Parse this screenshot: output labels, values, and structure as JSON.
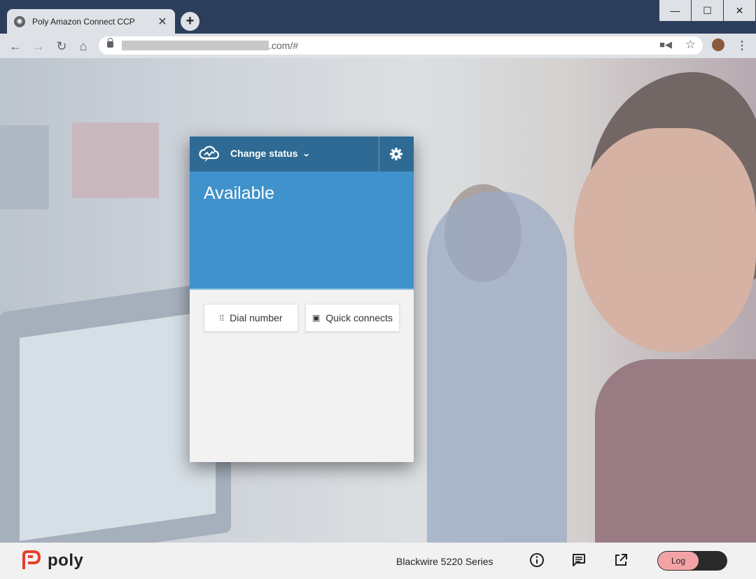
{
  "browser": {
    "tab_title": "Poly Amazon Connect CCP",
    "url_suffix": ".com/#",
    "new_tab": "+",
    "controls": {
      "minimize": "—",
      "maximize": "☐",
      "close": "✕"
    }
  },
  "ccp": {
    "status_button": "Change status",
    "state": "Available",
    "dial_number": "Dial number",
    "quick_connects": "Quick connects",
    "colors": {
      "header": "#2e6a93",
      "state_bg": "#3f92cb",
      "body": "#f2f2f2"
    }
  },
  "footer": {
    "brand": "poly",
    "device": "Blackwire 5220 Series",
    "log_label": "Log",
    "icons": [
      "info-icon",
      "chat-icon",
      "external-link-icon"
    ]
  }
}
